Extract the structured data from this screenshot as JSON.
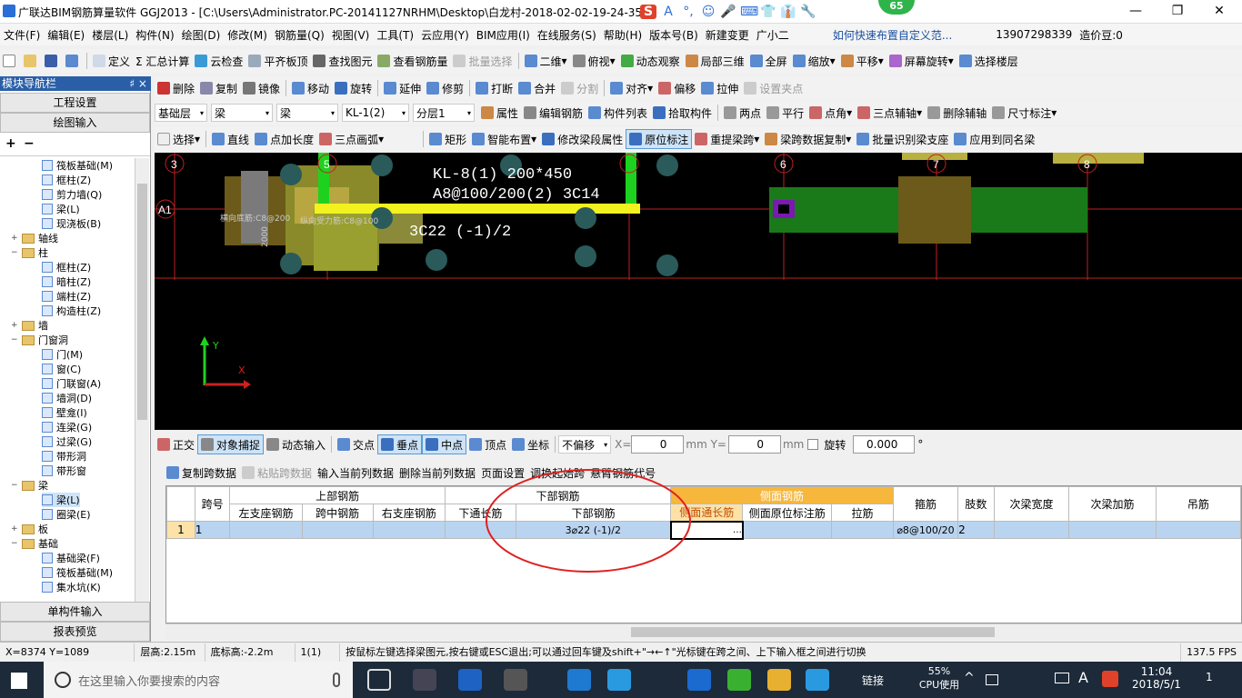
{
  "title": "广联达BIM钢筋算量软件 GGJ2013 - [C:\\Users\\Administrator.PC-20141127NRHM\\Desktop\\白龙村-2018-02-02-19-24-35",
  "badge": "65",
  "ime": [
    "S",
    "A",
    "°,",
    "☺",
    "🎤",
    "⌨",
    "👕",
    "👔",
    "🔧"
  ],
  "menu": [
    "文件(F)",
    "编辑(E)",
    "楼层(L)",
    "构件(N)",
    "绘图(D)",
    "修改(M)",
    "钢筋量(Q)",
    "视图(V)",
    "工具(T)",
    "云应用(Y)",
    "BIM应用(I)",
    "在线服务(S)",
    "帮助(H)",
    "版本号(B)",
    "新建变更",
    "广小二",
    "如何快速布置自定义范...",
    "13907298339",
    "造价豆:0"
  ],
  "toolbar1": [
    "定义",
    "Σ 汇总计算",
    "云检查",
    "平齐板顶",
    "查找图元",
    "查看钢筋量",
    "批量选择",
    "二维",
    "俯视",
    "动态观察",
    "局部三维",
    "全屏",
    "缩放",
    "平移",
    "屏幕旋转",
    "选择楼层"
  ],
  "toolbar2": [
    "删除",
    "复制",
    "镜像",
    "移动",
    "旋转",
    "延伸",
    "修剪",
    "打断",
    "合并",
    "分割",
    "对齐",
    "偏移",
    "拉伸",
    "设置夹点"
  ],
  "toolbar3": {
    "floor": "基础层",
    "type1": "梁",
    "type2": "梁",
    "comp": "KL-1(2)",
    "layer": "分层1",
    "items": [
      "属性",
      "编辑钢筋",
      "构件列表",
      "拾取构件",
      "两点",
      "平行",
      "点角",
      "三点辅轴",
      "删除辅轴",
      "尺寸标注"
    ]
  },
  "toolbar4": [
    "选择",
    "直线",
    "点加长度",
    "三点画弧",
    "矩形",
    "智能布置",
    "修改梁段属性",
    "原位标注",
    "重提梁跨",
    "梁跨数据复制",
    "批量识别梁支座",
    "应用到同名梁"
  ],
  "nav": {
    "header": "模块导航栏",
    "pin": "♯ ×",
    "btn1": "工程设置",
    "btn2": "绘图输入",
    "btn3": "单构件输入",
    "btn4": "报表预览"
  },
  "tree": [
    {
      "t": "筏板基础(M)",
      "lvl": 2,
      "k": "i"
    },
    {
      "t": "框柱(Z)",
      "lvl": 2,
      "k": "i"
    },
    {
      "t": "剪力墙(Q)",
      "lvl": 2,
      "k": "i"
    },
    {
      "t": "梁(L)",
      "lvl": 2,
      "k": "i"
    },
    {
      "t": "现浇板(B)",
      "lvl": 2,
      "k": "i"
    },
    {
      "t": "轴线",
      "lvl": 1,
      "k": "f",
      "e": "+"
    },
    {
      "t": "柱",
      "lvl": 1,
      "k": "f",
      "e": "−"
    },
    {
      "t": "框柱(Z)",
      "lvl": 2,
      "k": "i"
    },
    {
      "t": "暗柱(Z)",
      "lvl": 2,
      "k": "i"
    },
    {
      "t": "端柱(Z)",
      "lvl": 2,
      "k": "i"
    },
    {
      "t": "构造柱(Z)",
      "lvl": 2,
      "k": "i"
    },
    {
      "t": "墙",
      "lvl": 1,
      "k": "f",
      "e": "+"
    },
    {
      "t": "门窗洞",
      "lvl": 1,
      "k": "f",
      "e": "−"
    },
    {
      "t": "门(M)",
      "lvl": 2,
      "k": "i"
    },
    {
      "t": "窗(C)",
      "lvl": 2,
      "k": "i"
    },
    {
      "t": "门联窗(A)",
      "lvl": 2,
      "k": "i"
    },
    {
      "t": "墙洞(D)",
      "lvl": 2,
      "k": "i"
    },
    {
      "t": "壁龛(I)",
      "lvl": 2,
      "k": "i"
    },
    {
      "t": "连梁(G)",
      "lvl": 2,
      "k": "i"
    },
    {
      "t": "过梁(G)",
      "lvl": 2,
      "k": "i"
    },
    {
      "t": "带形洞",
      "lvl": 2,
      "k": "i"
    },
    {
      "t": "带形窗",
      "lvl": 2,
      "k": "i"
    },
    {
      "t": "梁",
      "lvl": 1,
      "k": "f",
      "e": "−"
    },
    {
      "t": "梁(L)",
      "lvl": 2,
      "k": "i"
    },
    {
      "t": "圈梁(E)",
      "lvl": 2,
      "k": "i"
    },
    {
      "t": "板",
      "lvl": 1,
      "k": "f",
      "e": "+"
    },
    {
      "t": "基础",
      "lvl": 1,
      "k": "f",
      "e": "−"
    },
    {
      "t": "基础梁(F)",
      "lvl": 2,
      "k": "i"
    },
    {
      "t": "筏板基础(M)",
      "lvl": 2,
      "k": "i"
    },
    {
      "t": "集水坑(K)",
      "lvl": 2,
      "k": "i"
    }
  ],
  "canvas": {
    "axis_labels": [
      "3",
      "5",
      "6",
      "7",
      "8",
      "A1"
    ],
    "beam_label1": "KL-8(1) 200*450",
    "beam_label2": "A8@100/200(2) 3C14",
    "beam_label3": "3C22 (-1)/2",
    "side_text1": "横向底筋:C8@200",
    "side_text2": "纵向受力筋:C8@100",
    "vert_text": "2000",
    "x_axis": "X",
    "y_axis": "Y"
  },
  "snap": {
    "items": [
      "正交",
      "对象捕捉",
      "动态输入",
      "交点",
      "垂点",
      "中点",
      "顶点",
      "坐标"
    ],
    "offset": "不偏移",
    "xlabel": "X=",
    "xval": "0",
    "ylabel": "mm Y=",
    "yval": "0",
    "unit": "mm",
    "rotate": "旋转",
    "rotval": "0.000",
    "deg": "°"
  },
  "gridtools": [
    "复制跨数据",
    "粘贴跨数据",
    "输入当前列数据",
    "删除当前列数据",
    "页面设置",
    "调换起始跨",
    "悬臂钢筋代号"
  ],
  "table": {
    "h1": [
      "跨号",
      "上部钢筋",
      "下部钢筋",
      "侧面钢筋",
      "箍筋",
      "肢数",
      "次梁宽度",
      "次梁加筋",
      "吊筋"
    ],
    "h2": [
      "左支座钢筋",
      "跨中钢筋",
      "右支座钢筋",
      "下通长筋",
      "下部钢筋",
      "侧面通长筋",
      "侧面原位标注筋",
      "拉筋"
    ],
    "row": {
      "idx": "1",
      "span": "1",
      "bottom": "3⌀22 (-1)/2",
      "stirrup": "⌀8@100/20",
      "legs": "2",
      "ellipsis": "…"
    }
  },
  "status": {
    "coord": "X=8374 Y=1089",
    "floorh": "层高:2.15m",
    "bottom": "底标高:-2.2m",
    "count": "1(1)",
    "hint": "按鼠标左键选择梁图元,按右键或ESC退出;可以通过回车键及shift+\"→←↑\"光标键在跨之间、上下输入框之间进行切换",
    "fps": "137.5 FPS"
  },
  "taskbar": {
    "search": "在这里输入你要搜索的内容",
    "link": "链接",
    "cpu": "55%",
    "cpu_label": "CPU使用",
    "time": "11:04",
    "date": "2018/5/1",
    "lang": "A",
    "notif": "1"
  }
}
